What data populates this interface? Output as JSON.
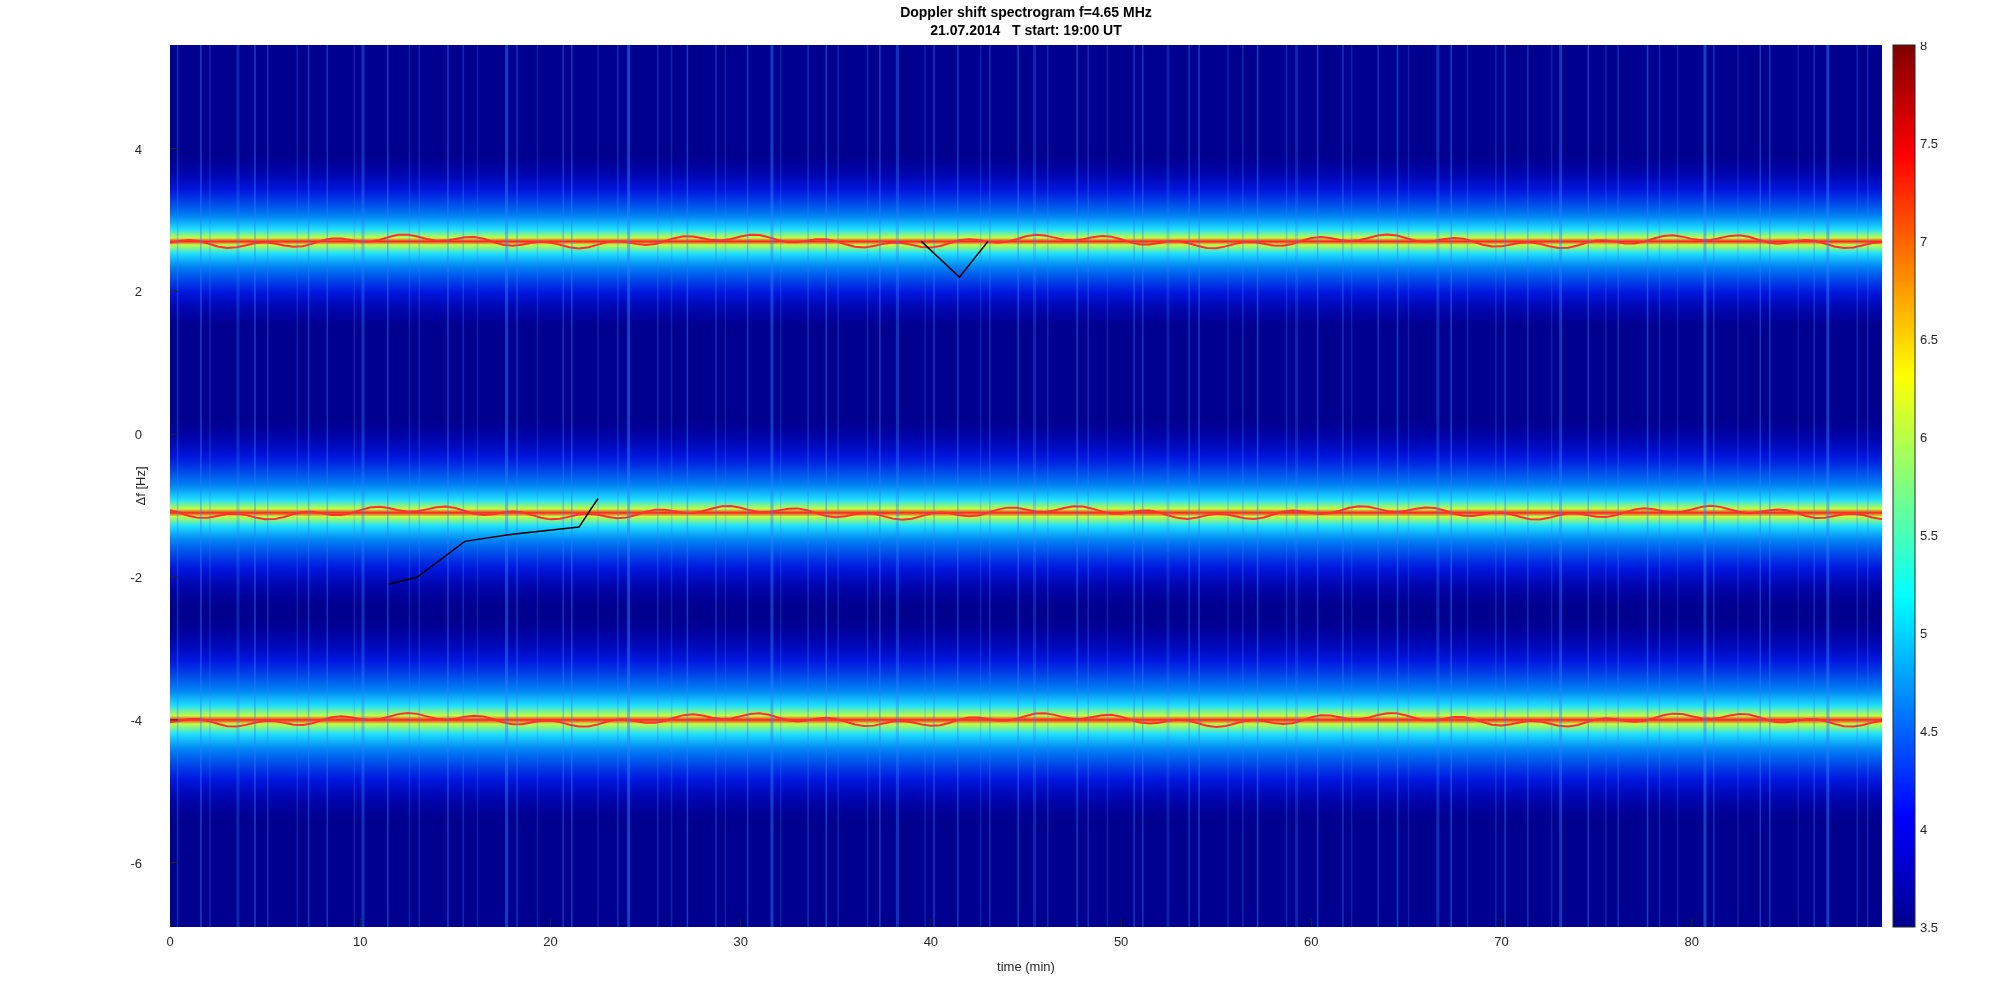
{
  "figure": {
    "title": "Doppler shift spectrogram f=4.65 MHz",
    "subtitle": "21.07.2014   T start: 19:00 UT"
  },
  "axes": {
    "xlabel": "time (min)",
    "ylabel": "Δf [Hz]",
    "xticks": [
      "0",
      "10",
      "20",
      "30",
      "40",
      "50",
      "60",
      "70",
      "80"
    ],
    "yticks": [
      "4",
      "2",
      "0",
      "-2",
      "-4",
      "-6"
    ]
  },
  "colorbar": {
    "ticks": [
      "8",
      "7.5",
      "7",
      "6.5",
      "6",
      "5.5",
      "5",
      "4.5",
      "4",
      "3.5"
    ]
  }
}
